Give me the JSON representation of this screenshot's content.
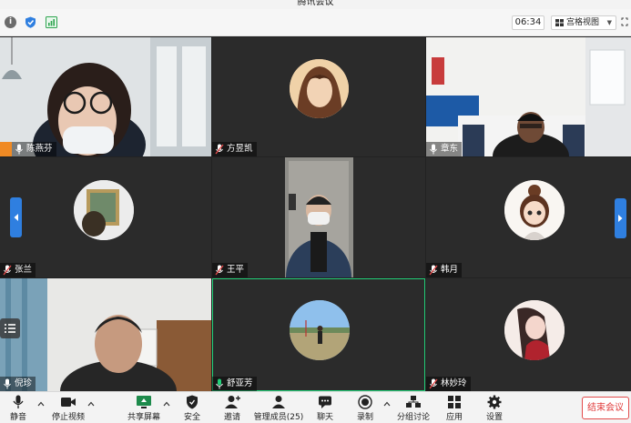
{
  "window": {
    "title": "腾讯会议"
  },
  "statusbar": {
    "info_icon": "info-icon",
    "security_icon": "shield-icon",
    "signal_icon": "signal-icon",
    "timer": "06:34",
    "view_label": "宫格视图"
  },
  "participants": [
    {
      "name": "陈燕芬",
      "host": true,
      "kind": "video",
      "mic": "on"
    },
    {
      "name": "方昱凯",
      "host": false,
      "kind": "avatar",
      "mic": "muted"
    },
    {
      "name": "章东",
      "host": false,
      "kind": "video",
      "mic": "on"
    },
    {
      "name": "张兰",
      "host": false,
      "kind": "avatar",
      "mic": "muted"
    },
    {
      "name": "王平",
      "host": false,
      "kind": "video",
      "mic": "muted"
    },
    {
      "name": "韩月",
      "host": false,
      "kind": "avatar",
      "mic": "muted"
    },
    {
      "name": "倪珍",
      "host": false,
      "kind": "video",
      "mic": "on"
    },
    {
      "name": "舒亚芳",
      "host": false,
      "kind": "avatar",
      "mic": "on",
      "speaking": true
    },
    {
      "name": "林妙玲",
      "host": false,
      "kind": "avatar",
      "mic": "muted"
    }
  ],
  "toolbar": {
    "mute": "静音",
    "stop_video": "停止视频",
    "share_screen": "共享屏幕",
    "security": "安全",
    "invite": "邀请",
    "manage_members": "管理成员(25)",
    "chat": "聊天",
    "record": "录制",
    "breakout": "分组讨论",
    "apps": "应用",
    "settings": "设置",
    "end_meeting": "结束会议"
  },
  "colors": {
    "accent_blue": "#2f7fe0",
    "speaking_green": "#23d17a",
    "end_red": "#e03a3a",
    "host_orange": "#f08a24"
  }
}
